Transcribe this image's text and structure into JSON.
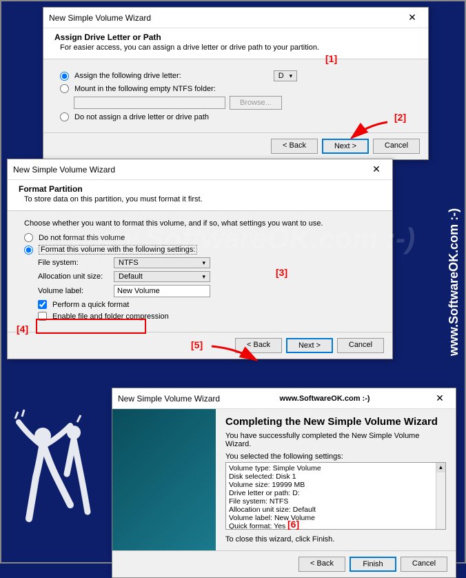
{
  "sidebar_text": "www.SoftwareOK.com :-)",
  "watermark_text": "www.SoftwareOK.com :-)",
  "dialog1": {
    "title": "New Simple Volume Wizard",
    "heading": "Assign Drive Letter or Path",
    "subheading": "For easier access, you can assign a drive letter or drive path to your partition.",
    "radio_assign": "Assign the following drive letter:",
    "drive_letter": "D",
    "radio_mount": "Mount in the following empty NTFS folder:",
    "browse_btn": "Browse...",
    "radio_none": "Do not assign a drive letter or drive path",
    "back_btn": "< Back",
    "next_btn": "Next >",
    "cancel_btn": "Cancel"
  },
  "dialog2": {
    "title": "New Simple Volume Wizard",
    "heading": "Format Partition",
    "subheading": "To store data on this partition, you must format it first.",
    "instruction": "Choose whether you want to format this volume, and if so, what settings you want to use.",
    "radio_noformat": "Do not format this volume",
    "radio_format": "Format this volume with the following settings:",
    "fs_label": "File system:",
    "fs_value": "NTFS",
    "alloc_label": "Allocation unit size:",
    "alloc_value": "Default",
    "volume_label": "Volume label:",
    "volume_value": "New Volume",
    "quick_format": "Perform a quick format",
    "compression": "Enable file and folder compression",
    "back_btn": "< Back",
    "next_btn": "Next >",
    "cancel_btn": "Cancel"
  },
  "dialog3": {
    "title": "New Simple Volume Wizard",
    "title_extra": "www.SoftwareOK.com :-)",
    "heading": "Completing the New Simple Volume Wizard",
    "success_text": "You have successfully completed the New Simple Volume Wizard.",
    "selected_label": "You selected the following settings:",
    "settings": [
      "Volume type: Simple Volume",
      "Disk selected: Disk 1",
      "Volume size: 19999 MB",
      "Drive letter or path: D:",
      "File system: NTFS",
      "Allocation unit size: Default",
      "Volume label: New Volume",
      "Quick format: Yes"
    ],
    "close_text": "To close this wizard, click Finish.",
    "back_btn": "< Back",
    "finish_btn": "Finish",
    "cancel_btn": "Cancel"
  },
  "annotations": {
    "a1": "[1]",
    "a2": "[2]",
    "a3": "[3]",
    "a4": "[4]",
    "a5": "[5]",
    "a6": "[6]"
  }
}
